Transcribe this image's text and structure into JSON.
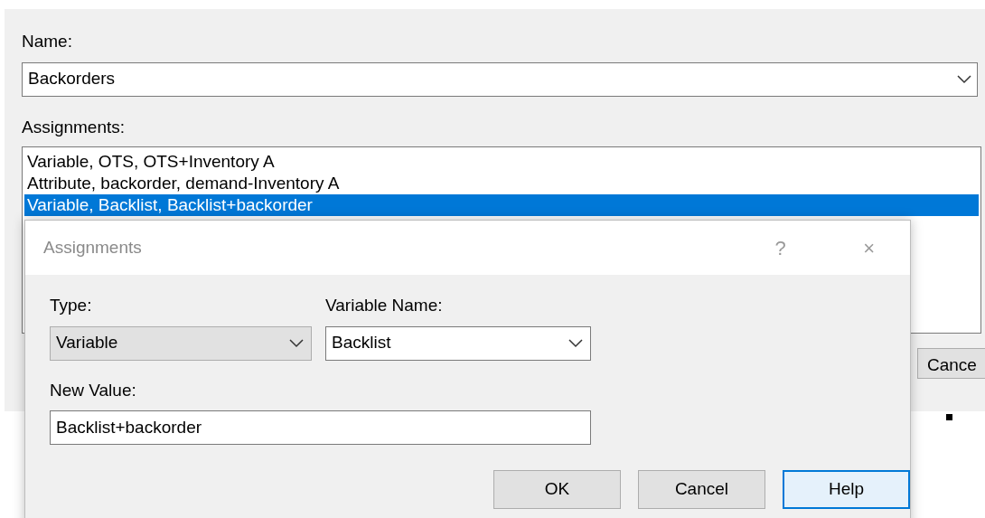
{
  "name_field": {
    "label": "Name:",
    "value": "Backorders"
  },
  "assignments": {
    "label": "Assignments:",
    "items": [
      {
        "text": "Variable, OTS, OTS+Inventory A",
        "selected": false
      },
      {
        "text": "Attribute, backorder, demand-Inventory A",
        "selected": false
      },
      {
        "text": "Variable, Backlist, Backlist+backorder",
        "selected": true
      }
    ]
  },
  "background_button": "Cance",
  "dialog": {
    "title": "Assignments",
    "help_glyph": "?",
    "close_glyph": "×",
    "fields": [
      {
        "kind": "list",
        "label": "Type:",
        "value": "Variable"
      },
      {
        "kind": "combo",
        "label": "Variable Name:",
        "value": "Backlist"
      },
      {
        "kind": "text",
        "label": "New Value:",
        "value": "Backlist+backorder"
      }
    ],
    "buttons": [
      {
        "label": "OK",
        "focused": false
      },
      {
        "label": "Cancel",
        "focused": false
      },
      {
        "label": "Help",
        "focused": true
      }
    ]
  }
}
